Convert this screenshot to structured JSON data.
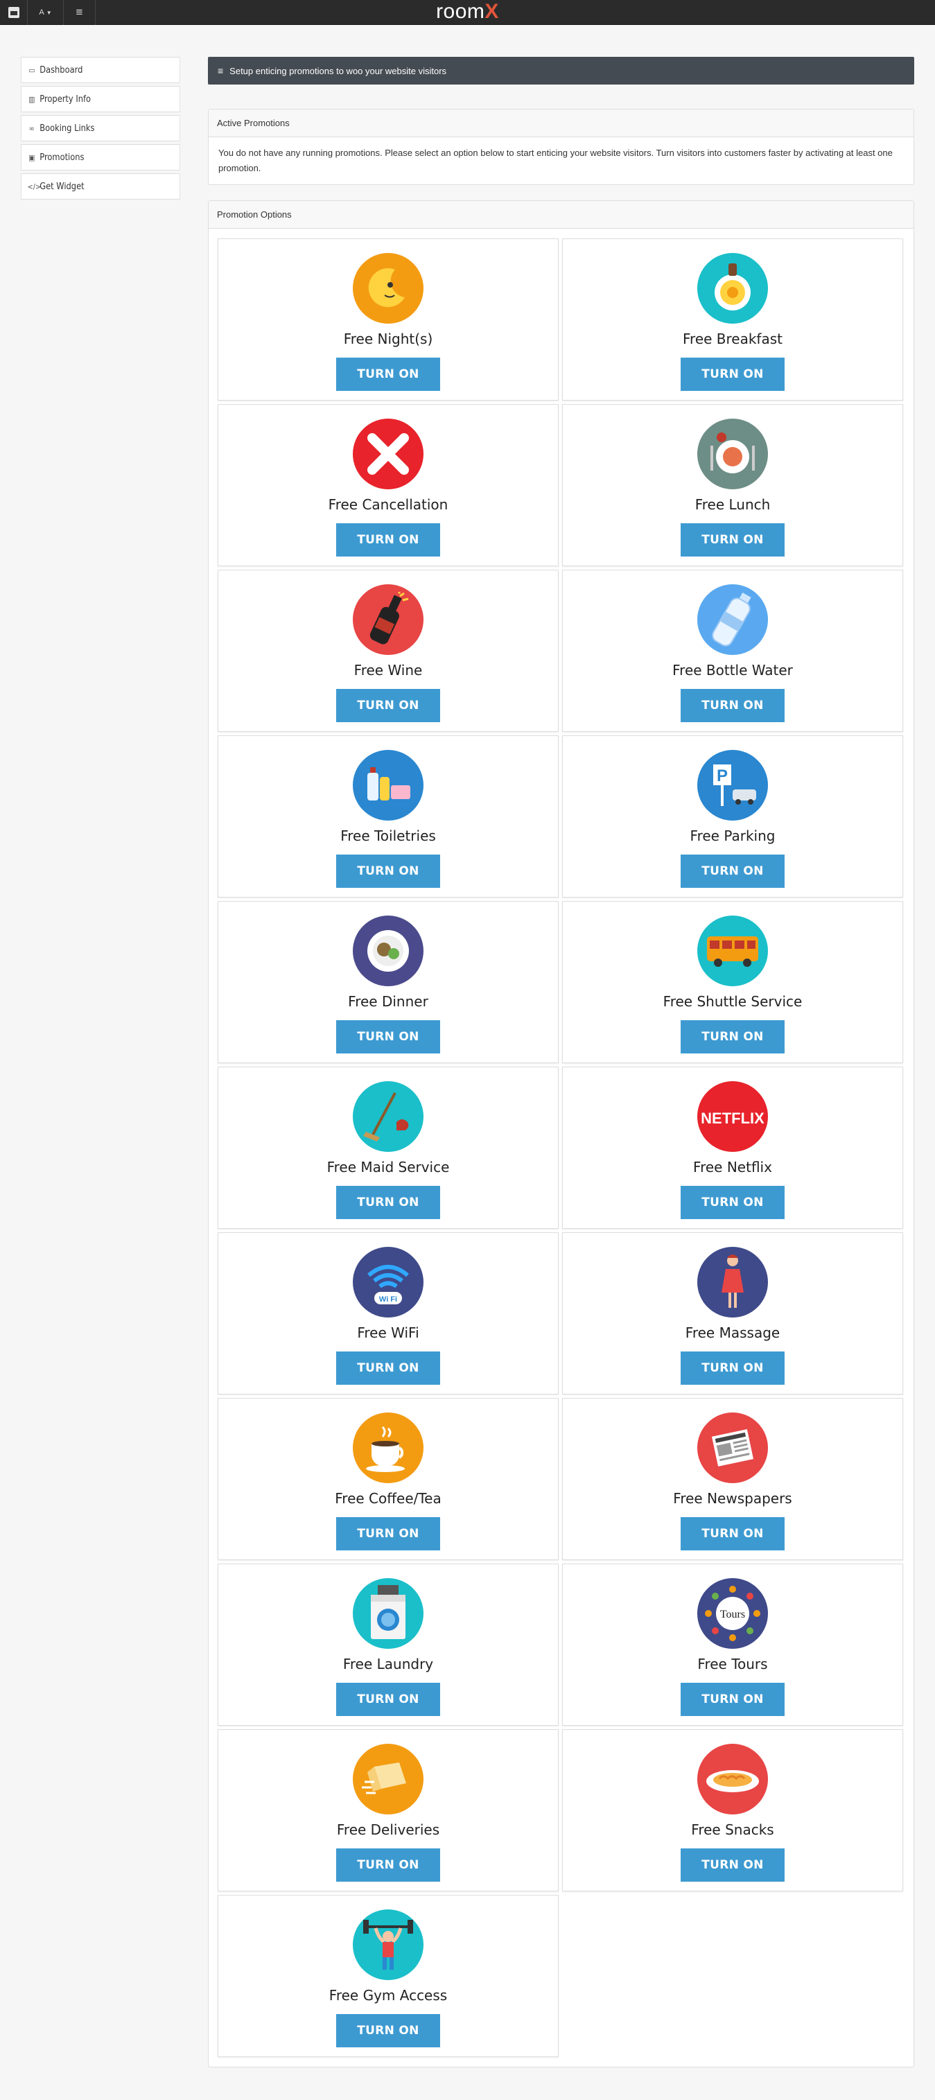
{
  "topbar": {
    "user_label": "A",
    "logo_main": "room",
    "logo_accent": "X"
  },
  "sidebar": {
    "items": [
      {
        "label": "Dashboard",
        "icon": "laptop-icon"
      },
      {
        "label": "Property Info",
        "icon": "building-icon"
      },
      {
        "label": "Booking Links",
        "icon": "link-icon"
      },
      {
        "label": "Promotions",
        "icon": "gift-icon"
      },
      {
        "label": "Get Widget",
        "icon": "code-icon"
      }
    ]
  },
  "main": {
    "banner": "Setup enticing promotions to woo your website visitors",
    "active": {
      "title": "Active Promotions",
      "message": "You do not have any running promotions. Please select an option below to start enticing your website visitors. Turn visitors into customers faster by activating at least one promotion."
    },
    "options": {
      "title": "Promotion Options",
      "button_label": "TURN ON",
      "items": [
        {
          "label": "Free Night(s)",
          "icon": "moon-icon",
          "color": "#f39c12"
        },
        {
          "label": "Free Breakfast",
          "icon": "breakfast-icon",
          "color": "#1abfc9"
        },
        {
          "label": "Free Cancellation",
          "icon": "cancel-x-icon",
          "color": "#e8232b"
        },
        {
          "label": "Free Lunch",
          "icon": "lunch-plate-icon",
          "color": "#6d8e86"
        },
        {
          "label": "Free Wine",
          "icon": "wine-bottle-icon",
          "color": "#e84545"
        },
        {
          "label": "Free Bottle Water",
          "icon": "water-bottle-icon",
          "color": "#5aa9f0"
        },
        {
          "label": "Free Toiletries",
          "icon": "toiletries-icon",
          "color": "#2a87d0"
        },
        {
          "label": "Free Parking",
          "icon": "parking-icon",
          "color": "#2a87d0"
        },
        {
          "label": "Free Dinner",
          "icon": "dinner-plate-icon",
          "color": "#4a4a8c"
        },
        {
          "label": "Free Shuttle Service",
          "icon": "shuttle-bus-icon",
          "color": "#1abfc9"
        },
        {
          "label": "Free Maid Service",
          "icon": "broom-icon",
          "color": "#1abfc9"
        },
        {
          "label": "Free Netflix",
          "icon": "netflix-icon",
          "color": "#e8232b"
        },
        {
          "label": "Free WiFi",
          "icon": "wifi-icon",
          "color": "#3f4a8a"
        },
        {
          "label": "Free Massage",
          "icon": "massage-icon",
          "color": "#3f4a8a"
        },
        {
          "label": "Free Coffee/Tea",
          "icon": "coffee-cup-icon",
          "color": "#f39c12"
        },
        {
          "label": "Free Newspapers",
          "icon": "newspaper-icon",
          "color": "#e84545"
        },
        {
          "label": "Free Laundry",
          "icon": "washing-machine-icon",
          "color": "#1abfc9"
        },
        {
          "label": "Free Tours",
          "icon": "tours-icon",
          "color": "#3f4a8a"
        },
        {
          "label": "Free Deliveries",
          "icon": "delivery-box-icon",
          "color": "#f39c12"
        },
        {
          "label": "Free Snacks",
          "icon": "snacks-plate-icon",
          "color": "#e84545"
        },
        {
          "label": "Free Gym Access",
          "icon": "gym-icon",
          "color": "#1abfc9"
        }
      ]
    }
  },
  "icon_text": {
    "netflix": "NETFLIX",
    "tours": "Tours",
    "wifi": "Wi Fi",
    "parking": "P"
  }
}
